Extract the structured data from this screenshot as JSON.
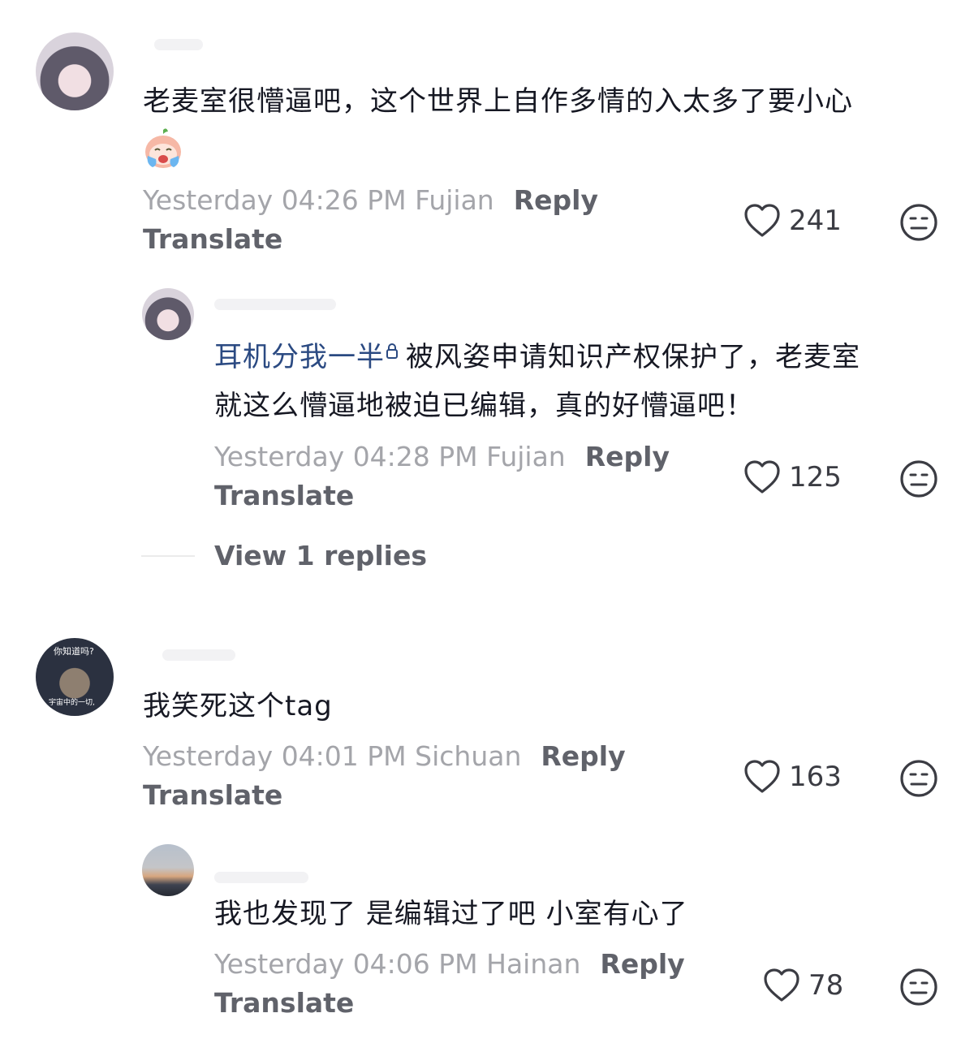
{
  "comments": [
    {
      "text": "老麦室很懵逼吧，这个世界上自作多情的入太多了要小心",
      "sticker_icon": "crying-peach-sticker-icon",
      "meta": "Yesterday 04:26 PM Fujian",
      "reply_label": "Reply",
      "translate_label": "Translate",
      "likes": "241",
      "replies": [
        {
          "mention": "耳机分我一半",
          "text_line1": "被风姿申请知识产权保护了，老麦室",
          "text_line2": "就这么懵逼地被迫已编辑，真的好懵逼吧！",
          "meta": "Yesterday 04:28 PM Fujian",
          "reply_label": "Reply",
          "translate_label": "Translate",
          "likes": "125"
        }
      ],
      "view_replies_label": "View 1 replies"
    },
    {
      "text": "我笑死这个tag",
      "avatar_caption_top": "你知道吗?",
      "avatar_caption_bottom": "宇宙中的一切,",
      "meta": "Yesterday 04:01 PM Sichuan",
      "reply_label": "Reply",
      "translate_label": "Translate",
      "likes": "163",
      "replies": [
        {
          "text": "我也发现了 是编辑过了吧 小室有心了",
          "meta": "Yesterday 04:06 PM Hainan",
          "reply_label": "Reply",
          "translate_label": "Translate",
          "likes": "78"
        }
      ]
    }
  ],
  "icons": {
    "like": "heart-outline-icon",
    "dislike": "neutral-face-icon",
    "mention_badge": "lock-badge-icon"
  },
  "colors": {
    "mention": "#2b4a82",
    "meta_gray": "#a4a5aa",
    "action_gray": "#60626a"
  }
}
